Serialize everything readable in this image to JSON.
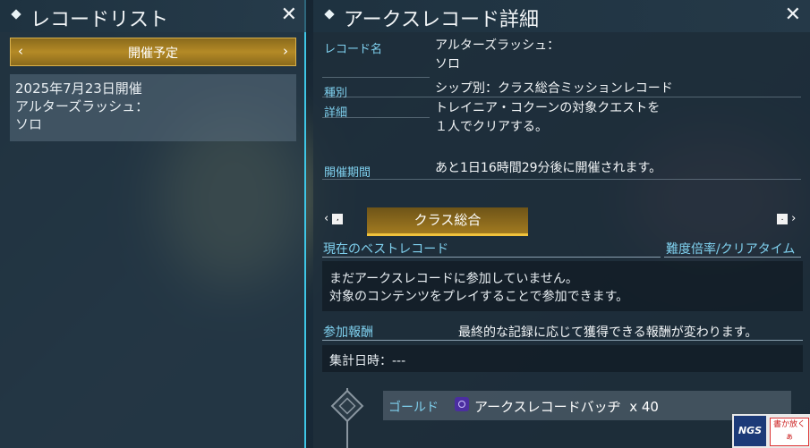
{
  "left_panel": {
    "title": "レコードリスト",
    "close": "✕",
    "schedule_filter": "開催予定",
    "item": {
      "date": "2025年7月23日開催",
      "name_line1": "アルターズラッシュ：",
      "name_line2": "ソロ"
    }
  },
  "right_panel": {
    "title": "アークスレコード詳細",
    "close": "✕",
    "record_name_label": "レコード名",
    "record_name_line1": "アルターズラッシュ：",
    "record_name_line2": "ソロ",
    "type_label": "種別",
    "type_value": "シップ別：クラス総合ミッションレコード",
    "detail_label": "詳細",
    "detail_line1": "トレイニア・コクーンの対象クエストを",
    "detail_line2": "１人でクリアする。",
    "period_label": "開催期間",
    "period_value": "あと1日16時間29分後に開催されます。",
    "class_tab": "クラス総合",
    "best_record_label": "現在のベストレコード",
    "difficulty_label": "難度倍率/クリアタイム",
    "best_msg_line1": "まだアークスレコードに参加していません。",
    "best_msg_line2": "対象のコンテンツをプレイすることで参加できます。",
    "reward_label": "参加報酬",
    "reward_note": "最終的な記録に応じて獲得できる報酬が変わります。",
    "tally_label": "集計日時：---",
    "reward_rank": "ゴールド",
    "reward_item": "アークスレコードバッヂ",
    "reward_qty": "x 40"
  },
  "logo": {
    "left": "NGS",
    "right": "書か放くぁ"
  },
  "colors": {
    "accent": "#3ec6e6",
    "gold": "#f0c23c",
    "label": "#7fd0ee"
  },
  "icons": [
    "diamond-bullet-icon",
    "close-icon",
    "chevron-left-icon",
    "chevron-right-icon",
    "badge-icon",
    "rank-diamond-icon"
  ]
}
